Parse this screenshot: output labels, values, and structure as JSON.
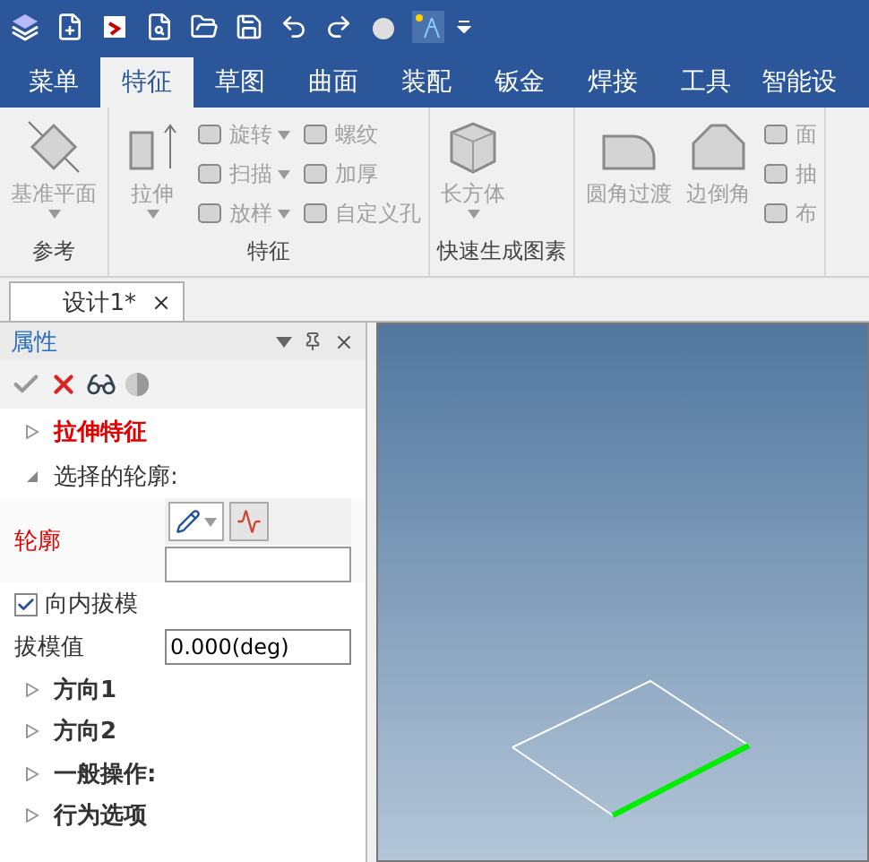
{
  "tabs": [
    {
      "label": "菜单",
      "selected": false
    },
    {
      "label": "特征",
      "selected": true
    },
    {
      "label": "草图",
      "selected": false
    },
    {
      "label": "曲面",
      "selected": false
    },
    {
      "label": "装配",
      "selected": false
    },
    {
      "label": "钣金",
      "selected": false
    },
    {
      "label": "焊接",
      "selected": false
    },
    {
      "label": "工具",
      "selected": false
    },
    {
      "label": "智能设",
      "selected": false
    }
  ],
  "ribbon": {
    "groups": [
      {
        "label": "参考",
        "large": [
          {
            "label": "基准平面",
            "dropdown": true,
            "kind": "plane"
          }
        ]
      },
      {
        "label": "特征",
        "large": [
          {
            "label": "拉伸",
            "dropdown": true,
            "kind": "extrude"
          }
        ],
        "small": [
          {
            "label": "旋转",
            "dropdown": true
          },
          {
            "label": "扫描",
            "dropdown": true
          },
          {
            "label": "放样",
            "dropdown": true
          },
          {
            "label": "螺纹",
            "dropdown": false
          },
          {
            "label": "加厚",
            "dropdown": false
          },
          {
            "label": "自定义孔",
            "dropdown": false
          }
        ]
      },
      {
        "label": "快速生成图素",
        "large": [
          {
            "label": "长方体",
            "dropdown": true,
            "kind": "box"
          }
        ]
      },
      {
        "large": [
          {
            "label": "圆角过渡",
            "dropdown": false,
            "kind": "fillet"
          },
          {
            "label": "边倒角",
            "dropdown": false,
            "kind": "chamfer"
          }
        ],
        "small": [
          {
            "label": "面",
            "dropdown": false
          },
          {
            "label": "抽",
            "dropdown": false
          },
          {
            "label": "布",
            "dropdown": false
          }
        ]
      }
    ]
  },
  "document_tab": {
    "label": "设计1*"
  },
  "properties_panel": {
    "title": "属性",
    "feature": {
      "label": "拉伸特征",
      "expanded": false
    },
    "profile_section": {
      "label": "选择的轮廓:",
      "expanded": true,
      "profile_label": "轮廓"
    },
    "draft_inward": {
      "label": "向内拔模",
      "checked": true
    },
    "draft_value": {
      "label": "拔模值",
      "value": "0.000(deg)"
    },
    "sections": [
      {
        "label": "方向1",
        "expanded": false
      },
      {
        "label": "方向2",
        "expanded": false
      },
      {
        "label": "一般操作:",
        "expanded": false
      },
      {
        "label": "行为选项",
        "expanded": false
      }
    ]
  }
}
